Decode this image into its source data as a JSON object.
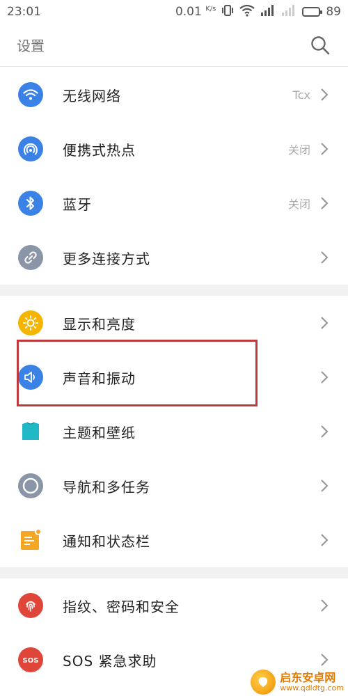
{
  "status_bar": {
    "time": "23:01",
    "speed": "0.01",
    "speed_unit": "K/s",
    "battery": "89",
    "battery_level": 0.89
  },
  "header": {
    "title": "设置",
    "search_icon": "search-icon"
  },
  "groups": [
    {
      "items": [
        {
          "label": "无线网络",
          "value": "Tcx",
          "icon": "wifi-icon",
          "color": "#3b82e6"
        },
        {
          "label": "便携式热点",
          "value": "关闭",
          "icon": "hotspot-icon",
          "color": "#3b82e6"
        },
        {
          "label": "蓝牙",
          "value": "关闭",
          "icon": "bluetooth-icon",
          "color": "#3b82e6"
        },
        {
          "label": "更多连接方式",
          "value": "",
          "icon": "link-icon",
          "color": "#8b95a8"
        }
      ]
    },
    {
      "items": [
        {
          "label": "显示和亮度",
          "value": "",
          "icon": "sun-icon",
          "color": "#f5b400"
        },
        {
          "label": "声音和振动",
          "value": "",
          "icon": "speaker-icon",
          "color": "#3b82e6"
        },
        {
          "label": "主题和壁纸",
          "value": "",
          "icon": "shirt-icon",
          "color": "#1fb8c4"
        },
        {
          "label": "导航和多任务",
          "value": "",
          "icon": "navigation-icon",
          "color": "#8b95a8"
        },
        {
          "label": "通知和状态栏",
          "value": "",
          "icon": "notification-icon",
          "color": "#f5a623"
        }
      ]
    },
    {
      "items": [
        {
          "label": "指纹、密码和安全",
          "value": "",
          "icon": "fingerprint-icon",
          "color": "#e0453a"
        },
        {
          "label": "SOS 紧急求助",
          "value": "",
          "icon": "sos-icon",
          "color": "#e0453a"
        }
      ]
    }
  ],
  "watermark": {
    "name": "启东安卓网",
    "url": "www.qdldtg.com"
  }
}
